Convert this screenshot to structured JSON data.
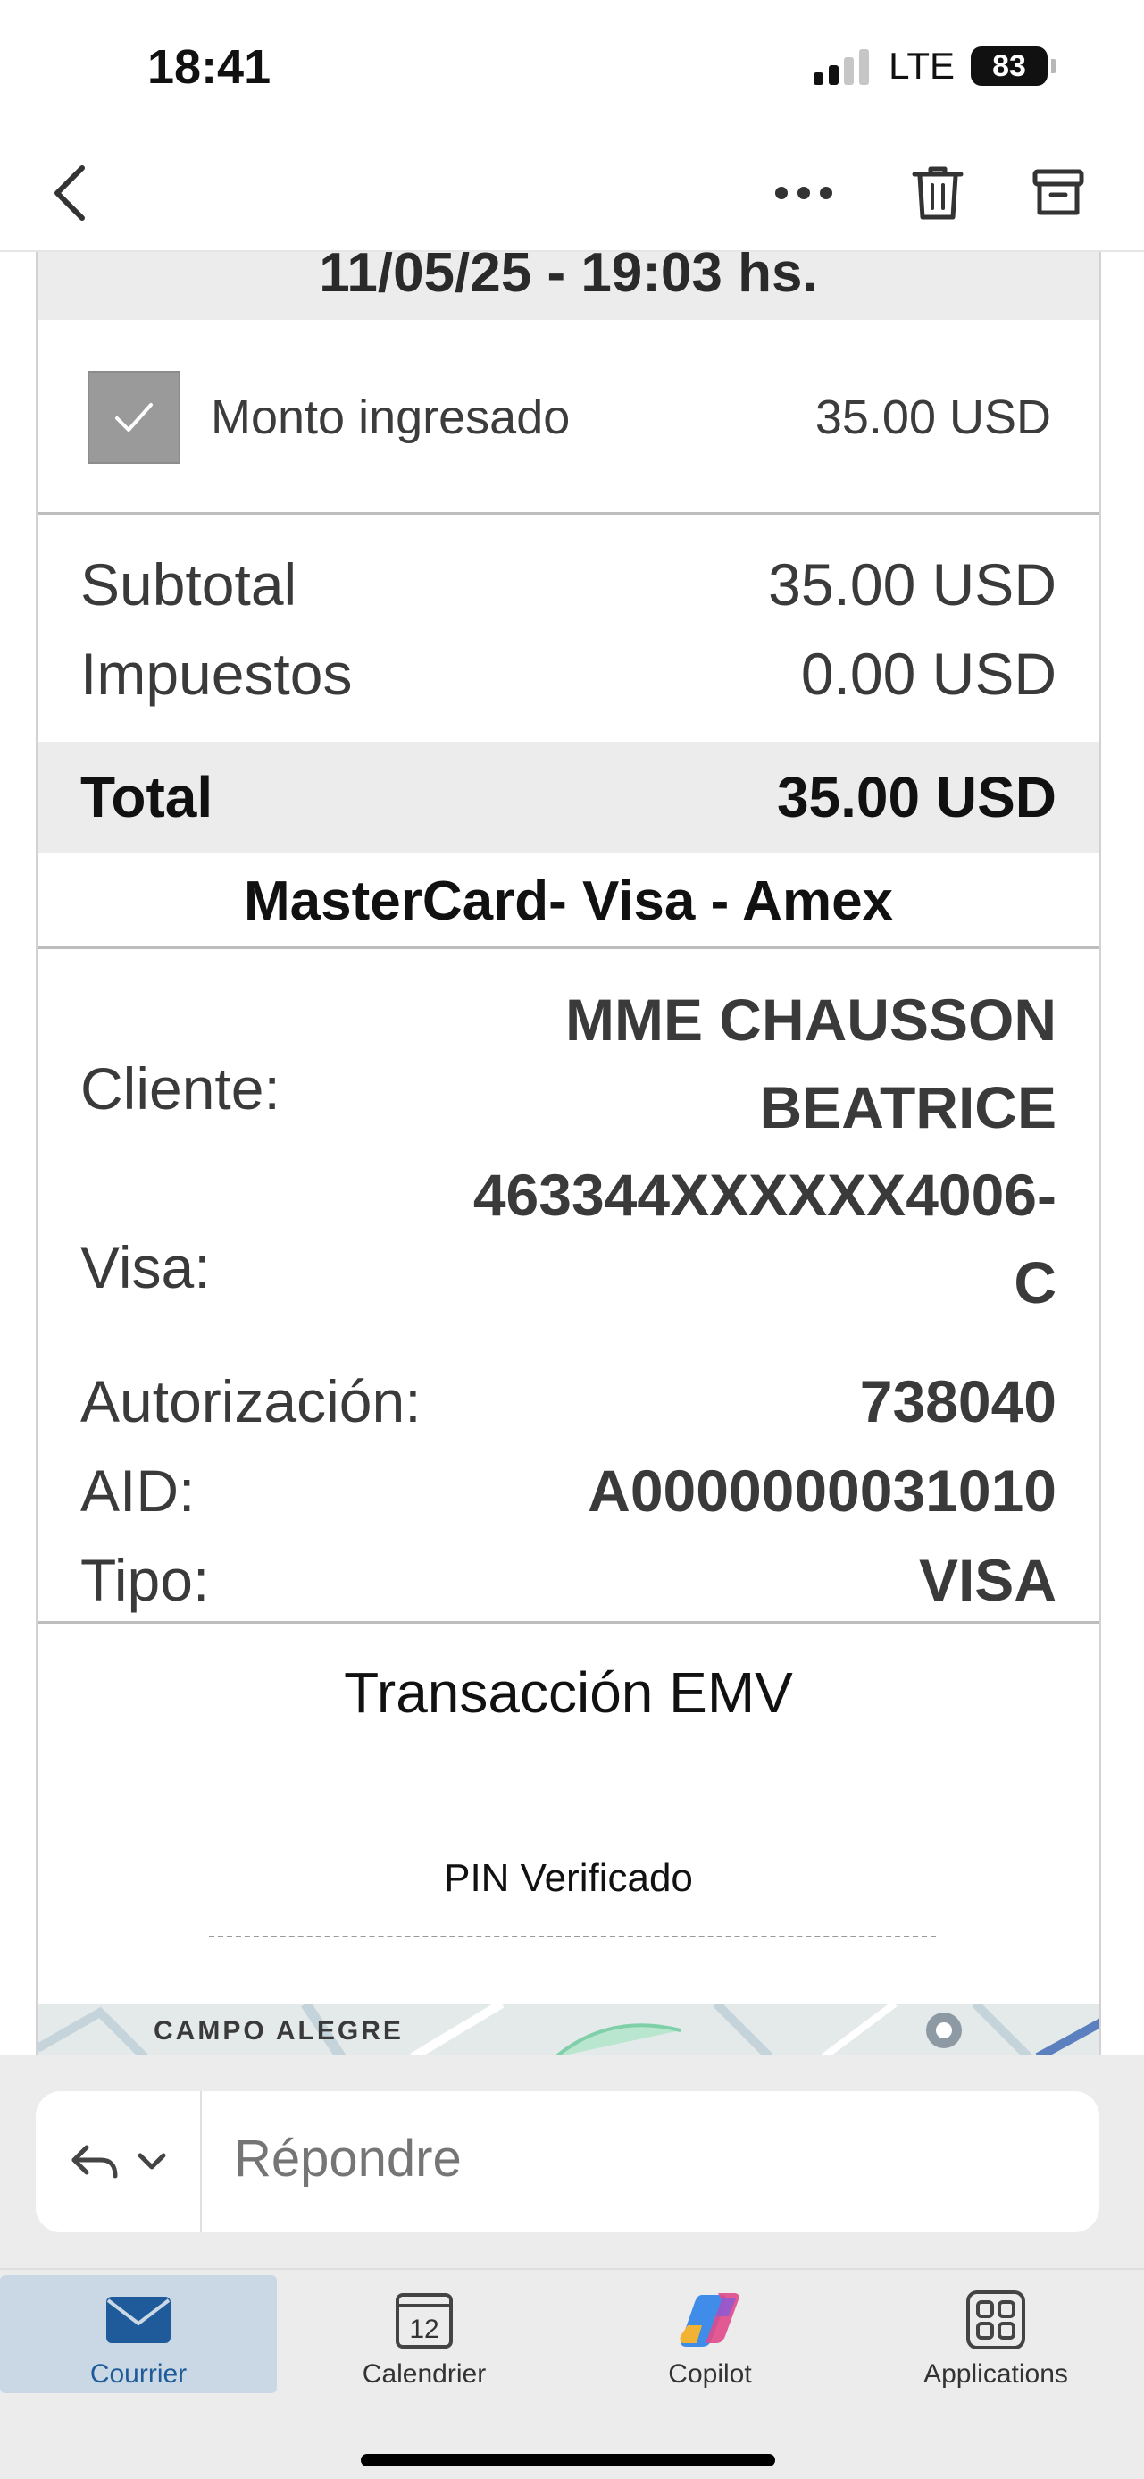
{
  "status_bar": {
    "time": "18:41",
    "network": "LTE",
    "battery": "83"
  },
  "nav": {
    "icons": [
      "chevron-left-icon",
      "more-icon",
      "trash-icon",
      "archive-icon"
    ]
  },
  "receipt": {
    "date_time": "11/05/25 - 19:03 hs.",
    "amount_entered": {
      "label": "Monto ingresado",
      "value": "35.00 USD",
      "checked": true
    },
    "subtotal": {
      "label": "Subtotal",
      "value": "35.00 USD"
    },
    "taxes": {
      "label": "Impuestos",
      "value": "0.00 USD"
    },
    "total": {
      "label": "Total",
      "value": "35.00 USD"
    },
    "card_networks": "MasterCard- Visa - Amex",
    "details": [
      {
        "label": "Cliente:",
        "value_lines": [
          "MME CHAUSSON",
          "BEATRICE"
        ]
      },
      {
        "label": "Visa:",
        "value_lines": [
          "463344XXXXXX4006-",
          "C"
        ]
      },
      {
        "label": "Autorización:",
        "value_lines": [
          "738040"
        ]
      },
      {
        "label": "AID:",
        "value_lines": [
          "A0000000031010"
        ]
      },
      {
        "label": "Tipo:",
        "value_lines": [
          "VISA"
        ]
      }
    ],
    "emv_title": "Transacción EMV",
    "pin_status": "PIN Verificado"
  },
  "map": {
    "label": "CAMPO ALEGRE"
  },
  "reply": {
    "placeholder": "Répondre"
  },
  "tabs": [
    {
      "label": "Courrier",
      "icon": "mail-icon",
      "active": true
    },
    {
      "label": "Calendrier",
      "icon": "calendar-icon",
      "date": "12",
      "active": false
    },
    {
      "label": "Copilot",
      "icon": "copilot-icon",
      "active": false
    },
    {
      "label": "Applications",
      "icon": "apps-grid-icon",
      "active": false
    }
  ],
  "colors": {
    "accent": "#1f5b9a",
    "active_tab_bg": "#c9d8e4",
    "band_gray": "#ececec"
  }
}
